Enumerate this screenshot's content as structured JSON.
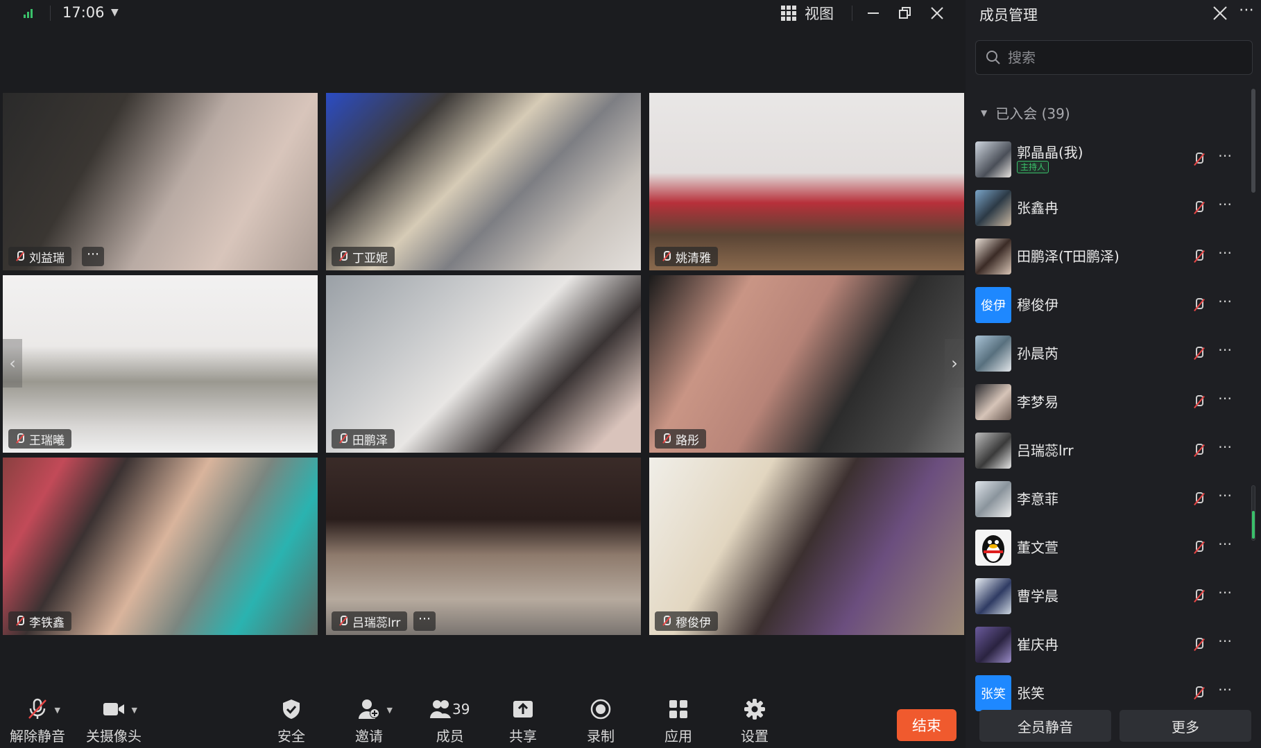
{
  "topbar": {
    "time": "17:06",
    "view_label": "视图"
  },
  "tiles": [
    {
      "name": "刘益瑞",
      "has_more": true
    },
    {
      "name": "丁亚妮",
      "has_more": false
    },
    {
      "name": "姚清雅",
      "has_more": false
    },
    {
      "name": "王瑞曦",
      "has_more": false
    },
    {
      "name": "田鹏泽",
      "has_more": false
    },
    {
      "name": "路彤",
      "has_more": false
    },
    {
      "name": "李铁鑫",
      "has_more": false
    },
    {
      "name": "吕瑞蕊lrr",
      "has_more": true
    },
    {
      "name": "穆俊伊",
      "has_more": false
    }
  ],
  "toolbar": {
    "unmute": "解除静音",
    "camera": "关摄像头",
    "security": "安全",
    "invite": "邀请",
    "members": "成员",
    "member_count": "39",
    "share": "共享",
    "record": "录制",
    "apps": "应用",
    "settings": "设置",
    "end": "结束"
  },
  "panel": {
    "title": "成员管理",
    "search_placeholder": "搜索",
    "group_label": "已入会 (39)",
    "members": [
      {
        "name": "郭晶晶(我)",
        "role": "主持人",
        "avatar": "photo"
      },
      {
        "name": "张鑫冉",
        "avatar": "photo"
      },
      {
        "name": "田鹏泽(T田鹏泽)",
        "avatar": "photo"
      },
      {
        "name": "穆俊伊",
        "avatar_text": "俊伊"
      },
      {
        "name": "孙晨芮",
        "avatar": "photo"
      },
      {
        "name": "李梦易",
        "avatar": "photo"
      },
      {
        "name": "吕瑞蕊lrr",
        "avatar": "photo"
      },
      {
        "name": "李意菲",
        "avatar": "photo"
      },
      {
        "name": "董文萱",
        "avatar": "penguin"
      },
      {
        "name": "曹学晨",
        "avatar": "photo"
      },
      {
        "name": "崔庆冉",
        "avatar": "photo"
      },
      {
        "name": "张笑",
        "avatar_text": "张笑"
      }
    ],
    "mute_all": "全员静音",
    "more": "更多"
  },
  "colors": {
    "accent_end": "#f05a2e",
    "host_badge": "#3ac06a",
    "mic_off": "#e64545",
    "text_avatar": "#1e88ff"
  }
}
